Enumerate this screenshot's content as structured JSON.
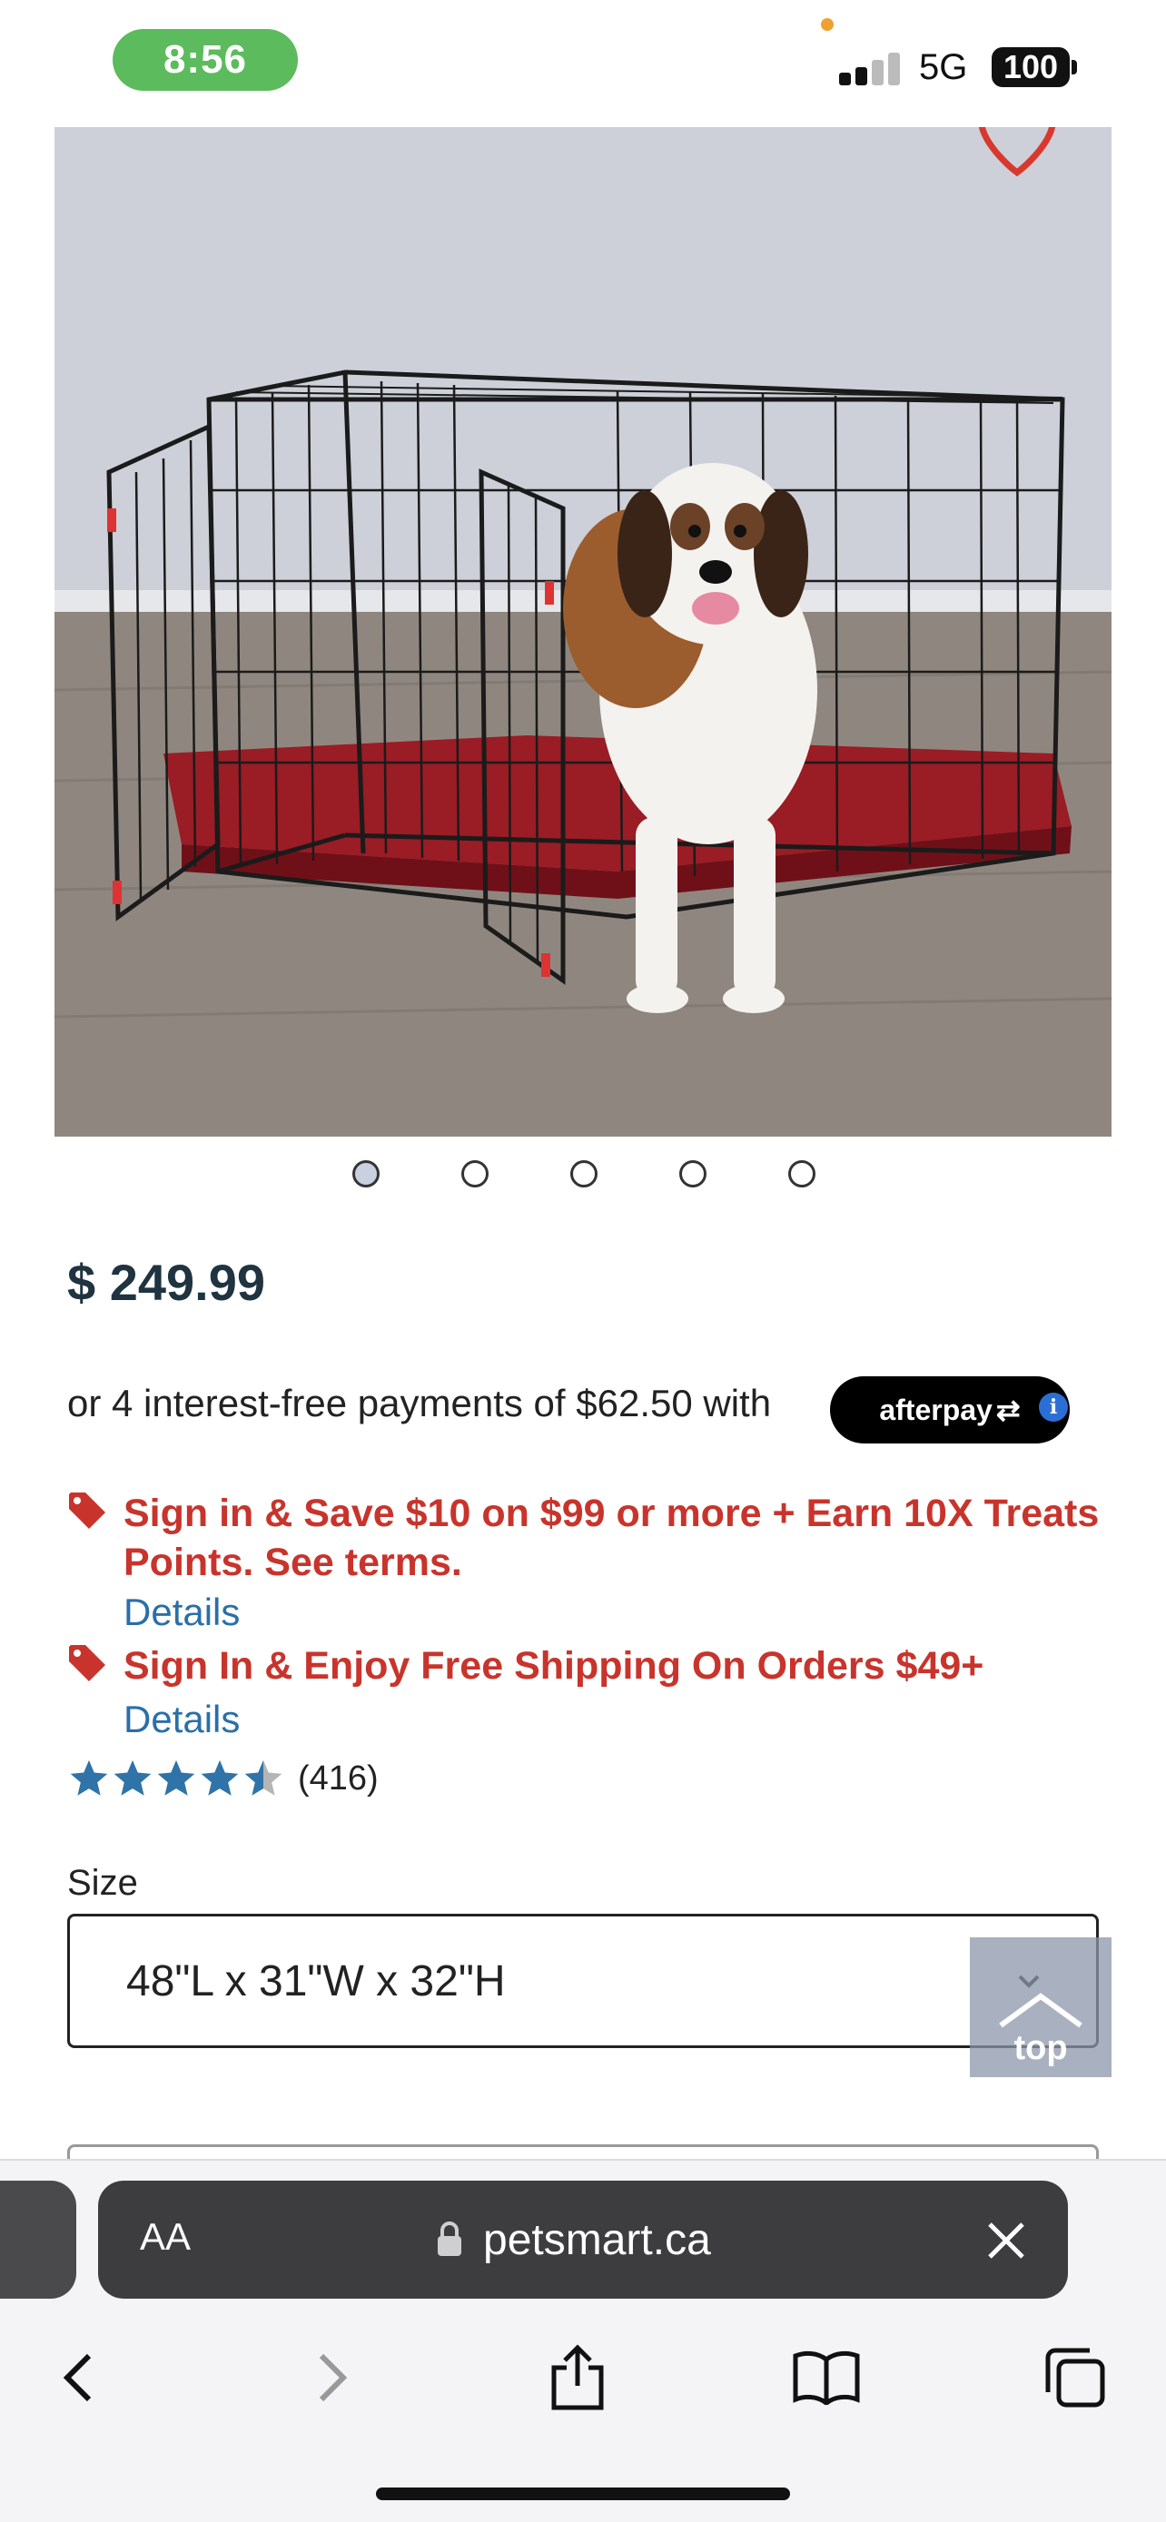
{
  "status_bar": {
    "time": "8:56",
    "network": "5G",
    "battery": "100",
    "signal_bars": 2
  },
  "product": {
    "image_alt": "dog-crate-product-photo",
    "carousel": {
      "total": 5,
      "active_index": 0
    },
    "price": "$ 249.99",
    "installments_text": "or 4 interest-free payments of $62.50 with",
    "afterpay_label": "afterpay",
    "promos": [
      {
        "text": "Sign in & Save $10 on $99 or more + Earn 10X Treats Points. See terms.",
        "link": "Details"
      },
      {
        "text": "Sign In & Enjoy Free Shipping On Orders $49+",
        "link": "Details"
      }
    ],
    "rating": {
      "stars": 4.5,
      "count": "(416)"
    },
    "size": {
      "label": "Size",
      "value": "48\"L x 31\"W x 32\"H"
    },
    "top_button_label": "top"
  },
  "browser": {
    "reader_label": "AA",
    "url": "petsmart.ca"
  },
  "colors": {
    "promo_red": "#c8342c",
    "link_blue": "#2a6fa8",
    "star_blue": "#2f73a8",
    "price_navy": "#1f3340",
    "favorite_red": "#d9382e"
  },
  "icons": {
    "favorite": "heart-icon",
    "info": "info-icon",
    "promo": "tag-icon",
    "lock": "lock-icon",
    "close": "close-icon",
    "back": "chevron-left-icon",
    "forward": "chevron-right-icon",
    "share": "share-icon",
    "bookmarks": "book-icon",
    "tabs": "tabs-icon"
  }
}
